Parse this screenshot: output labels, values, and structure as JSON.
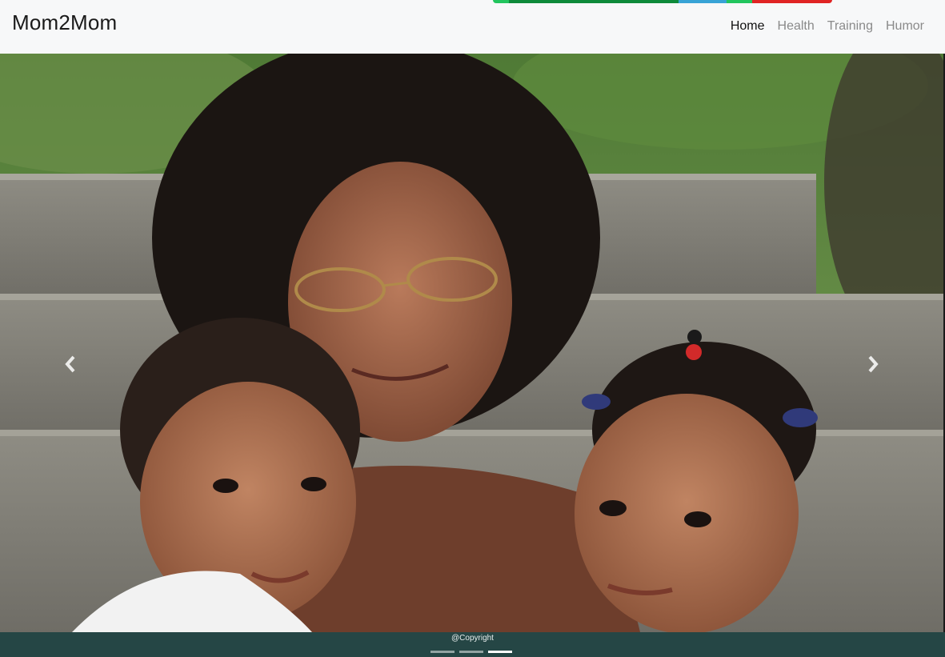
{
  "navbar": {
    "brand": "Mom2Mom",
    "links": [
      {
        "label": "Home",
        "active": true
      },
      {
        "label": "Health",
        "active": false
      },
      {
        "label": "Training",
        "active": false
      },
      {
        "label": "Humor",
        "active": false
      }
    ]
  },
  "carousel": {
    "slide_count": 3,
    "active_index": 2,
    "prev_icon": "chevron-left-icon",
    "next_icon": "chevron-right-icon",
    "image_alt": ""
  },
  "footer": {
    "copyright": "@Copyright"
  },
  "colors": {
    "navbar_bg": "#f7f8f9",
    "footer_bg": "#254645",
    "brand_text": "#1a1a1a",
    "nav_inactive": "#8a8a8a",
    "nav_active": "#111111"
  }
}
